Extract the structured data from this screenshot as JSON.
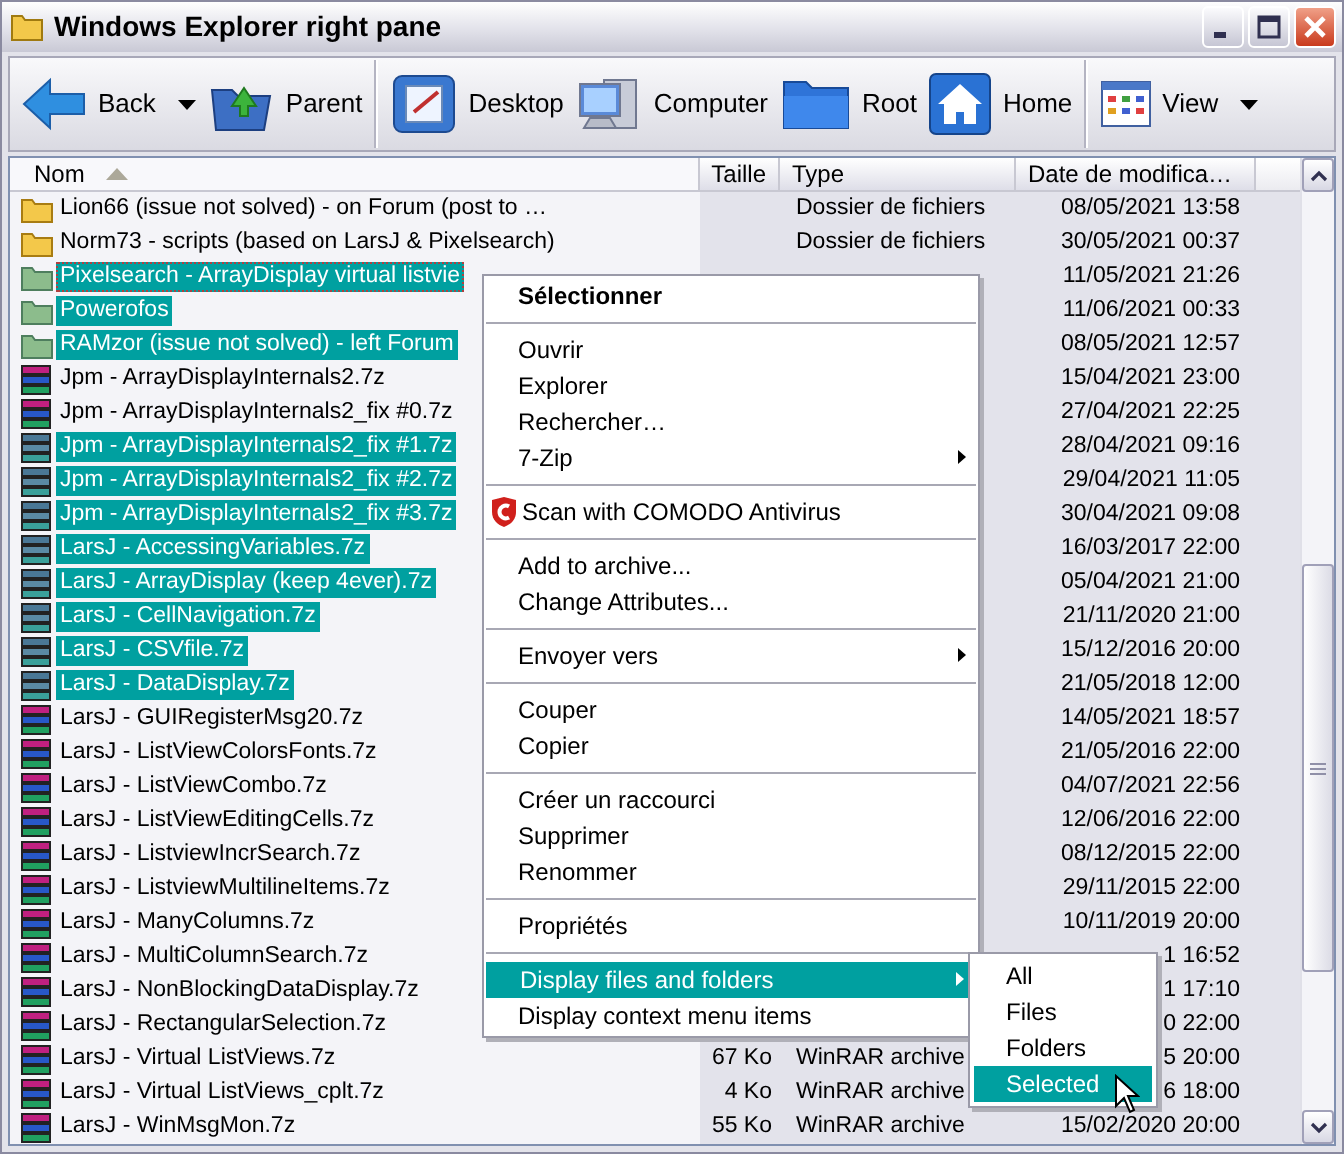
{
  "window": {
    "title": "Windows Explorer right pane"
  },
  "toolbar": [
    {
      "label": "Back",
      "kind": "back",
      "dropdown": true
    },
    {
      "label": "Parent",
      "kind": "parent",
      "dropdown": false
    },
    {
      "kind": "separator"
    },
    {
      "label": "Desktop",
      "kind": "desktop",
      "dropdown": false
    },
    {
      "label": "Computer",
      "kind": "computer",
      "dropdown": false
    },
    {
      "label": "Root",
      "kind": "root",
      "dropdown": false
    },
    {
      "label": "Home",
      "kind": "home",
      "dropdown": false
    },
    {
      "kind": "separator"
    },
    {
      "label": "View",
      "kind": "view",
      "dropdown": true
    }
  ],
  "file_list": {
    "columns": [
      {
        "label": "Nom",
        "sorted": true
      },
      {
        "label": "Taille",
        "sorted": false
      },
      {
        "label": "Type",
        "sorted": false
      },
      {
        "label": "Date de modifica…",
        "sorted": false
      }
    ],
    "rows": [
      {
        "kind": "folder",
        "name": "Lion66 (issue not solved) - on Forum (post to …",
        "type": "Dossier de fichiers",
        "date": "08/05/2021 13:58",
        "selected": false,
        "focused": false
      },
      {
        "kind": "folder",
        "name": "Norm73 - scripts (based on LarsJ & Pixelsearch)",
        "type": "Dossier de fichiers",
        "date": "30/05/2021 00:37",
        "selected": false,
        "focused": false
      },
      {
        "kind": "folder",
        "name": "Pixelsearch - ArrayDisplay virtual listvie",
        "date": "11/05/2021 21:26",
        "selected": true,
        "focused": true
      },
      {
        "kind": "folder",
        "name": "Powerofos",
        "date": "11/06/2021 00:33",
        "selected": true,
        "focused": false
      },
      {
        "kind": "folder",
        "name": "RAMzor (issue not solved) - left Forum",
        "date": "08/05/2021 12:57",
        "selected": true,
        "focused": false
      },
      {
        "kind": "archive",
        "name": "Jpm - ArrayDisplayInternals2.7z",
        "date": "15/04/2021 23:00",
        "selected": false,
        "focused": false
      },
      {
        "kind": "archive",
        "name": "Jpm - ArrayDisplayInternals2_fix #0.7z",
        "date": "27/04/2021 22:25",
        "selected": false,
        "focused": false
      },
      {
        "kind": "archive",
        "name": "Jpm - ArrayDisplayInternals2_fix #1.7z",
        "date": "28/04/2021 09:16",
        "selected": true,
        "focused": false
      },
      {
        "kind": "archive",
        "name": "Jpm - ArrayDisplayInternals2_fix #2.7z",
        "date": "29/04/2021 11:05",
        "selected": true,
        "focused": false
      },
      {
        "kind": "archive",
        "name": "Jpm - ArrayDisplayInternals2_fix #3.7z",
        "date": "30/04/2021 09:08",
        "selected": true,
        "focused": false
      },
      {
        "kind": "archive",
        "name": "LarsJ - AccessingVariables.7z",
        "date": "16/03/2017 22:00",
        "selected": true,
        "focused": false
      },
      {
        "kind": "archive",
        "name": "LarsJ - ArrayDisplay (keep 4ever).7z",
        "date": "05/04/2021 21:00",
        "selected": true,
        "focused": false
      },
      {
        "kind": "archive",
        "name": "LarsJ - CellNavigation.7z",
        "date": "21/11/2020 21:00",
        "selected": true,
        "focused": false
      },
      {
        "kind": "archive",
        "name": "LarsJ - CSVfile.7z",
        "date": "15/12/2016 20:00",
        "selected": true,
        "focused": false
      },
      {
        "kind": "archive",
        "name": "LarsJ - DataDisplay.7z",
        "date": "21/05/2018 12:00",
        "selected": true,
        "focused": false
      },
      {
        "kind": "archive",
        "name": "LarsJ - GUIRegisterMsg20.7z",
        "date": "14/05/2021 18:57",
        "selected": false,
        "focused": false
      },
      {
        "kind": "archive",
        "name": "LarsJ - ListViewColorsFonts.7z",
        "date": "21/05/2016 22:00",
        "selected": false,
        "focused": false
      },
      {
        "kind": "archive",
        "name": "LarsJ - ListViewCombo.7z",
        "date": "04/07/2021 22:56",
        "selected": false,
        "focused": false
      },
      {
        "kind": "archive",
        "name": "LarsJ - ListViewEditingCells.7z",
        "date": "12/06/2016 22:00",
        "selected": false,
        "focused": false
      },
      {
        "kind": "archive",
        "name": "LarsJ - ListviewIncrSearch.7z",
        "date": "08/12/2015 22:00",
        "selected": false,
        "focused": false
      },
      {
        "kind": "archive",
        "name": "LarsJ - ListviewMultilineItems.7z",
        "date": "29/11/2015 22:00",
        "selected": false,
        "focused": false
      },
      {
        "kind": "archive",
        "name": "LarsJ - ManyColumns.7z",
        "date": "10/11/2019 20:00",
        "selected": false,
        "focused": false
      },
      {
        "kind": "archive",
        "name": "LarsJ - MultiColumnSearch.7z",
        "date": "1 16:52",
        "selected": false,
        "focused": false
      },
      {
        "kind": "archive",
        "name": "LarsJ - NonBlockingDataDisplay.7z",
        "date": "1 17:10",
        "selected": false,
        "focused": false
      },
      {
        "kind": "archive",
        "name": "LarsJ - RectangularSelection.7z",
        "date": "0 22:00",
        "selected": false,
        "focused": false
      },
      {
        "kind": "archive",
        "name": "LarsJ - Virtual ListViews.7z",
        "size": "67 Ko",
        "type": "WinRAR archive",
        "date": "5 20:00",
        "selected": false,
        "focused": false
      },
      {
        "kind": "archive",
        "name": "LarsJ - Virtual ListViews_cplt.7z",
        "size": "4 Ko",
        "type": "WinRAR archive",
        "date": "6 18:00",
        "selected": false,
        "focused": false
      },
      {
        "kind": "archive",
        "name": "LarsJ - WinMsgMon.7z",
        "size": "55 Ko",
        "type": "WinRAR archive",
        "date": "15/02/2020 20:00",
        "selected": false,
        "focused": false
      }
    ]
  },
  "context_menu": {
    "items": [
      {
        "kind": "default",
        "label": "Sélectionner",
        "submenu": false,
        "selected": false
      },
      {
        "kind": "separator"
      },
      {
        "kind": "item",
        "label": "Ouvrir",
        "submenu": false,
        "selected": false
      },
      {
        "kind": "item",
        "label": "Explorer",
        "submenu": false,
        "selected": false
      },
      {
        "kind": "item",
        "label": "Rechercher…",
        "submenu": false,
        "selected": false
      },
      {
        "kind": "item",
        "label": "7-Zip",
        "submenu": true,
        "selected": false
      },
      {
        "kind": "separator"
      },
      {
        "kind": "shield",
        "label": "Scan with COMODO Antivirus",
        "submenu": false,
        "selected": false
      },
      {
        "kind": "separator"
      },
      {
        "kind": "item",
        "label": "Add to archive...",
        "submenu": false,
        "selected": false
      },
      {
        "kind": "item",
        "label": "Change Attributes...",
        "submenu": false,
        "selected": false
      },
      {
        "kind": "separator"
      },
      {
        "kind": "item",
        "label": "Envoyer vers",
        "submenu": true,
        "selected": false
      },
      {
        "kind": "separator"
      },
      {
        "kind": "item",
        "label": "Couper",
        "submenu": false,
        "selected": false
      },
      {
        "kind": "item",
        "label": "Copier",
        "submenu": false,
        "selected": false
      },
      {
        "kind": "separator"
      },
      {
        "kind": "item",
        "label": "Créer un raccourci",
        "submenu": false,
        "selected": false
      },
      {
        "kind": "item",
        "label": "Supprimer",
        "submenu": false,
        "selected": false
      },
      {
        "kind": "item",
        "label": "Renommer",
        "submenu": false,
        "selected": false
      },
      {
        "kind": "separator"
      },
      {
        "kind": "item",
        "label": "Propriétés",
        "submenu": false,
        "selected": false
      },
      {
        "kind": "separator"
      },
      {
        "kind": "item",
        "label": "Display files and folders",
        "submenu": true,
        "selected": true
      },
      {
        "kind": "item",
        "label": "Display context menu items",
        "submenu": false,
        "selected": false
      }
    ]
  },
  "submenu": {
    "items": [
      {
        "label": "All",
        "selected": false
      },
      {
        "label": "Files",
        "selected": false
      },
      {
        "label": "Folders",
        "selected": false
      },
      {
        "label": "Selected",
        "selected": true
      }
    ]
  }
}
